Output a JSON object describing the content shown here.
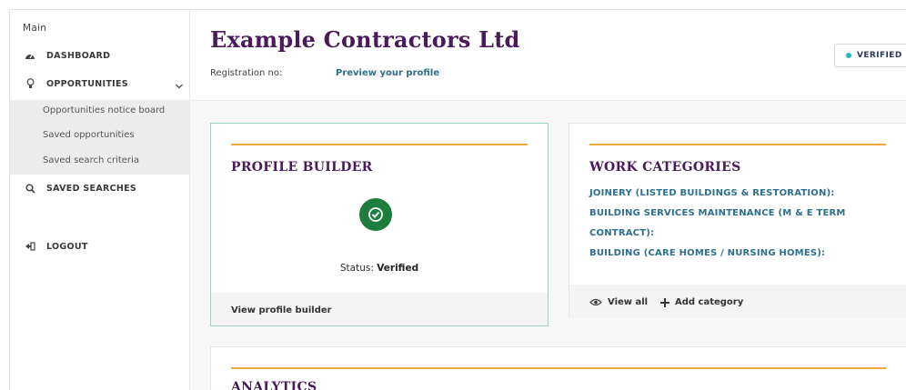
{
  "sidebar": {
    "heading": "Main",
    "items": [
      {
        "label": "DASHBOARD",
        "icon": "dashboard-icon"
      },
      {
        "label": "OPPORTUNITIES",
        "icon": "lightbulb-icon"
      },
      {
        "label": "SAVED SEARCHES",
        "icon": "search-icon"
      },
      {
        "label": "LOGOUT",
        "icon": "logout-icon"
      }
    ],
    "sub_items": [
      {
        "label": "Opportunities notice board"
      },
      {
        "label": "Saved opportunities"
      },
      {
        "label": "Saved search criteria"
      }
    ]
  },
  "header": {
    "title": "Example Contractors Ltd",
    "registration_label": "Registration no:",
    "preview_link": "Preview your profile",
    "badge": "VERIFIED"
  },
  "profile_builder": {
    "title": "PROFILE BUILDER",
    "status_label": "Status:",
    "status_value": "Verified",
    "footer_link": "View profile builder"
  },
  "work_categories": {
    "title": "WORK CATEGORIES",
    "lines": [
      "JOINERY (LISTED BUILDINGS & RESTORATION):",
      "BUILDING SERVICES MAINTENANCE (M & E TERM",
      "CONTRACT):",
      "BUILDING (CARE HOMES / NURSING HOMES):"
    ],
    "view_all": "View all",
    "add_category": "Add category"
  },
  "analytics": {
    "title": "ANALYTICS"
  },
  "colors": {
    "title_purple": "#4a1a5a",
    "link_blue": "#2d6f8e",
    "accent_orange": "#f2a93b",
    "verified_green": "#1c7d3c",
    "badge_dot": "#2ab7c4"
  }
}
